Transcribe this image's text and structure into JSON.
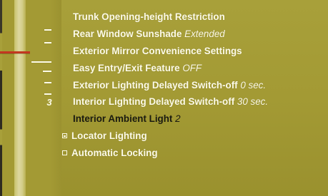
{
  "wheel": {
    "value": "3"
  },
  "menu": {
    "items": [
      {
        "label": "Trunk Opening-height Restriction",
        "value": ""
      },
      {
        "label": "Rear Window Sunshade",
        "value": "Extended"
      },
      {
        "label": "Exterior Mirror Convenience Settings",
        "value": ""
      },
      {
        "label": "Easy Entry/Exit Feature",
        "value": "OFF"
      },
      {
        "label": "Exterior Lighting Delayed Switch-off",
        "value": "0 sec."
      },
      {
        "label": "Interior Lighting Delayed Switch-off",
        "value": "30 sec."
      },
      {
        "label": "Interior Ambient Light",
        "value": "2"
      },
      {
        "label": "Locator Lighting",
        "value": ""
      },
      {
        "label": "Automatic Locking",
        "value": ""
      }
    ]
  },
  "colors": {
    "background": "#a39a34",
    "text": "#fdfbe8",
    "selected_text": "#1a1a10",
    "marker": "#c2371f"
  },
  "selected_index": 6,
  "checkboxes": {
    "locator_lighting": true,
    "automatic_locking": false
  }
}
